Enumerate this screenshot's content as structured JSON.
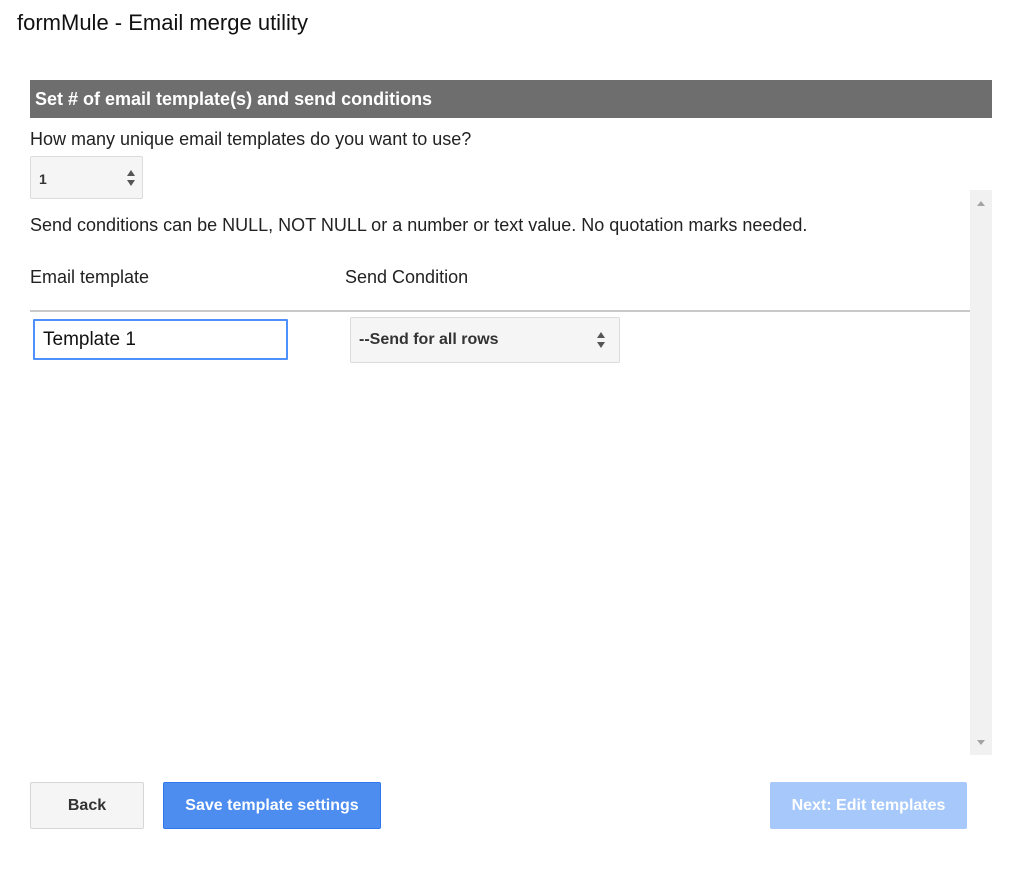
{
  "app": {
    "title": "formMule - Email merge utility"
  },
  "section": {
    "header": "Set # of email template(s) and send conditions"
  },
  "templates_count": {
    "question": "How many unique email templates do you want to use?",
    "value": "1"
  },
  "conditions": {
    "note": "Send conditions can be NULL, NOT NULL or a number or text value. No quotation marks needed.",
    "columns": {
      "template": "Email template",
      "condition": "Send Condition"
    },
    "rows": [
      {
        "template_name": "Template 1",
        "condition": "--Send for all rows"
      }
    ]
  },
  "buttons": {
    "back": "Back",
    "save": "Save template settings",
    "next": "Next: Edit templates"
  },
  "colors": {
    "header_bg": "#6e6e6e",
    "primary": "#4d8df0",
    "primary_disabled": "#a6c8fa",
    "focus_border": "#4d90fe"
  }
}
